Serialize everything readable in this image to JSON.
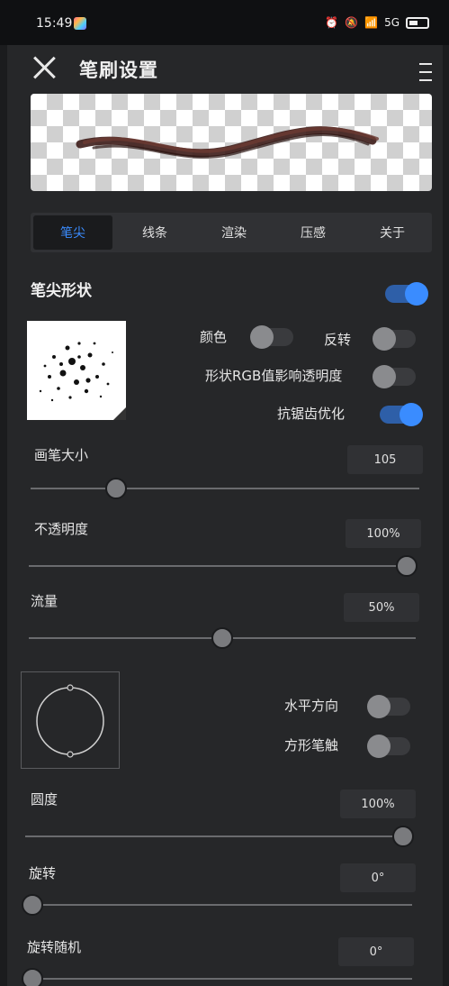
{
  "status": {
    "time": "15:49",
    "signal": "5G"
  },
  "header": {
    "title": "笔刷设置"
  },
  "tabs": [
    {
      "label": "笔尖",
      "active": true
    },
    {
      "label": "线条",
      "active": false
    },
    {
      "label": "渲染",
      "active": false
    },
    {
      "label": "压感",
      "active": false
    },
    {
      "label": "关于",
      "active": false
    }
  ],
  "tip_shape": {
    "title": "笔尖形状",
    "enabled": true,
    "color_label": "颜色",
    "color_on": false,
    "invert_label": "反转",
    "invert_on": false,
    "rgb_label": "形状RGB值影响透明度",
    "rgb_on": false,
    "antialias_label": "抗锯齿优化",
    "antialias_on": true
  },
  "sliders": {
    "size": {
      "label": "画笔大小",
      "value": "105",
      "fraction": 0.22
    },
    "opacity": {
      "label": "不透明度",
      "value": "100%",
      "fraction": 1.0
    },
    "flow": {
      "label": "流量",
      "value": "50%",
      "fraction": 0.5
    },
    "roundness": {
      "label": "圆度",
      "value": "100%",
      "fraction": 1.0
    },
    "rotation": {
      "label": "旋转",
      "value": "0°",
      "fraction": 0.0
    },
    "rotation_random": {
      "label": "旋转随机",
      "value": "0°",
      "fraction": 0.0
    }
  },
  "direction": {
    "horizontal_label": "水平方向",
    "horizontal_on": false,
    "square_label": "方形笔触",
    "square_on": false
  },
  "colors": {
    "accent": "#3a8cff",
    "stroke": "#5a2a24"
  }
}
